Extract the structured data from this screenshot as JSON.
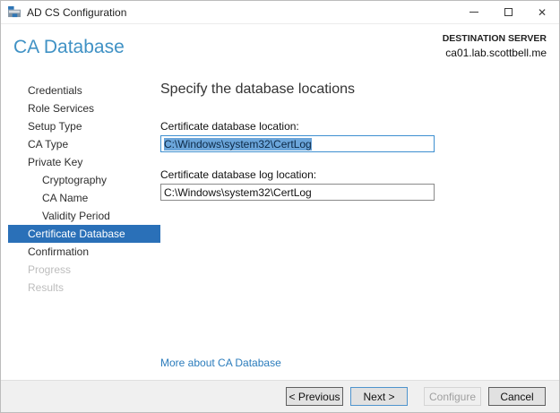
{
  "window": {
    "title": "AD CS Configuration"
  },
  "icons": {
    "app": "adcs-wizard-icon",
    "minimize": "minimize-icon",
    "maximize": "maximize-icon",
    "close": "✕"
  },
  "header": {
    "page_title": "CA Database",
    "destination_label": "DESTINATION SERVER",
    "destination_server": "ca01.lab.scottbell.me"
  },
  "sidebar": {
    "items": [
      {
        "label": "Credentials",
        "state": "enabled",
        "indent": false
      },
      {
        "label": "Role Services",
        "state": "enabled",
        "indent": false
      },
      {
        "label": "Setup Type",
        "state": "enabled",
        "indent": false
      },
      {
        "label": "CA Type",
        "state": "enabled",
        "indent": false
      },
      {
        "label": "Private Key",
        "state": "enabled",
        "indent": false
      },
      {
        "label": "Cryptography",
        "state": "enabled",
        "indent": true
      },
      {
        "label": "CA Name",
        "state": "enabled",
        "indent": true
      },
      {
        "label": "Validity Period",
        "state": "enabled",
        "indent": true
      },
      {
        "label": "Certificate Database",
        "state": "selected",
        "indent": false
      },
      {
        "label": "Confirmation",
        "state": "enabled",
        "indent": false
      },
      {
        "label": "Progress",
        "state": "disabled",
        "indent": false
      },
      {
        "label": "Results",
        "state": "disabled",
        "indent": false
      }
    ]
  },
  "main": {
    "heading": "Specify the database locations",
    "fields": [
      {
        "label": "Certificate database location:",
        "value": "C:\\Windows\\system32\\CertLog",
        "text_selected": true
      },
      {
        "label": "Certificate database log location:",
        "value": "C:\\Windows\\system32\\CertLog",
        "text_selected": false
      }
    ],
    "link": "More about CA Database"
  },
  "footer": {
    "buttons": [
      {
        "label": "< Previous",
        "state": "enabled"
      },
      {
        "label": "Next >",
        "state": "default"
      },
      {
        "label": "Configure",
        "state": "disabled"
      },
      {
        "label": "Cancel",
        "state": "enabled"
      }
    ]
  },
  "colors": {
    "header_blue": "#4092c5",
    "nav_selected_blue": "#2a70b8",
    "link_blue": "#2b7cbc",
    "selection_highlight": "#6ba5da",
    "footer_bg": "#f0f0f0",
    "focused_input_border": "#3d8fd0"
  }
}
